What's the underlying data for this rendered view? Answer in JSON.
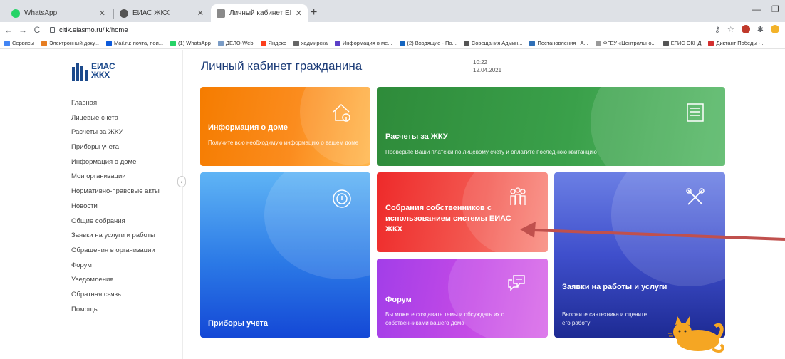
{
  "browser": {
    "tabs": [
      {
        "title": "WhatsApp",
        "color": "#25d366"
      },
      {
        "title": "ЕИАС ЖКХ",
        "color": "#555555"
      },
      {
        "title": "Личный кабинет ЕИАС ЖКХ",
        "color": "#8a8a8a"
      }
    ],
    "url": "citlk.eiasmo.ru/lk/home",
    "bookmarks": [
      {
        "label": "Сервисы",
        "color": "#4285f4"
      },
      {
        "label": "Электронный доку...",
        "color": "#e67e22"
      },
      {
        "label": "Mail.ru: почта, пои...",
        "color": "#0c5adb"
      },
      {
        "label": "(1) WhatsApp",
        "color": "#25d366"
      },
      {
        "label": "ДЕЛО-Web",
        "color": "#7a9cc6"
      },
      {
        "label": "Яндекс",
        "color": "#fc3f1d"
      },
      {
        "label": "хадмирска",
        "color": "#666666"
      },
      {
        "label": "Информация в ме...",
        "color": "#5b3fc7"
      },
      {
        "label": "(2) Входящие - По...",
        "color": "#1565c0"
      },
      {
        "label": "Совещания Админ...",
        "color": "#555555"
      },
      {
        "label": "Постановления | А...",
        "color": "#2f6fb6"
      },
      {
        "label": "ФГБУ «Центрально...",
        "color": "#999999"
      },
      {
        "label": "ЕГИС ОКНД",
        "color": "#555555"
      },
      {
        "label": "Диктант Победы -...",
        "color": "#d32f2f"
      }
    ]
  },
  "logo": {
    "line1": "ЕИАС",
    "line2": "ЖКХ"
  },
  "sidebar": {
    "items": [
      "Главная",
      "Лицевые счета",
      "Расчеты за ЖКУ",
      "Приборы учета",
      "Информация о доме",
      "Мои организации",
      "Нормативно-правовые акты",
      "Новости",
      "Общие собрания",
      "Заявки на услуги и работы",
      "Обращения в организации",
      "Форум",
      "Уведомления",
      "Обратная связь",
      "Помощь"
    ]
  },
  "header": {
    "title": "Личный кабинет гражданина",
    "time": "10:22",
    "date": "12.04.2021"
  },
  "cards": {
    "house": {
      "title": "Информация о доме",
      "desc": "Получите всю необходимую информацию о вашем доме",
      "icon": "house-info-icon"
    },
    "payments": {
      "title": "Расчеты за ЖКУ",
      "desc": "Проверьте Ваши платежи по лицевому счету и оплатите последнюю квитанцию",
      "icon": "receipt-icon"
    },
    "meters": {
      "title": "Приборы учета",
      "icon": "meter-icon"
    },
    "meetings": {
      "title": "Собрания собственников с использованием системы ЕИАС ЖКХ",
      "icon": "people-icon"
    },
    "forum": {
      "title": "Форум",
      "desc": "Вы можете создавать темы и обсуждать их с собственниками вашего дома",
      "icon": "chat-bubbles-icon"
    },
    "requests": {
      "title": "Заявки на работы и услуги",
      "desc": "Вызовите сантехника и оцените его работу!",
      "icon": "tools-icon"
    }
  },
  "colors": {
    "arrow": "#c0504d",
    "title": "#1c3c78"
  }
}
